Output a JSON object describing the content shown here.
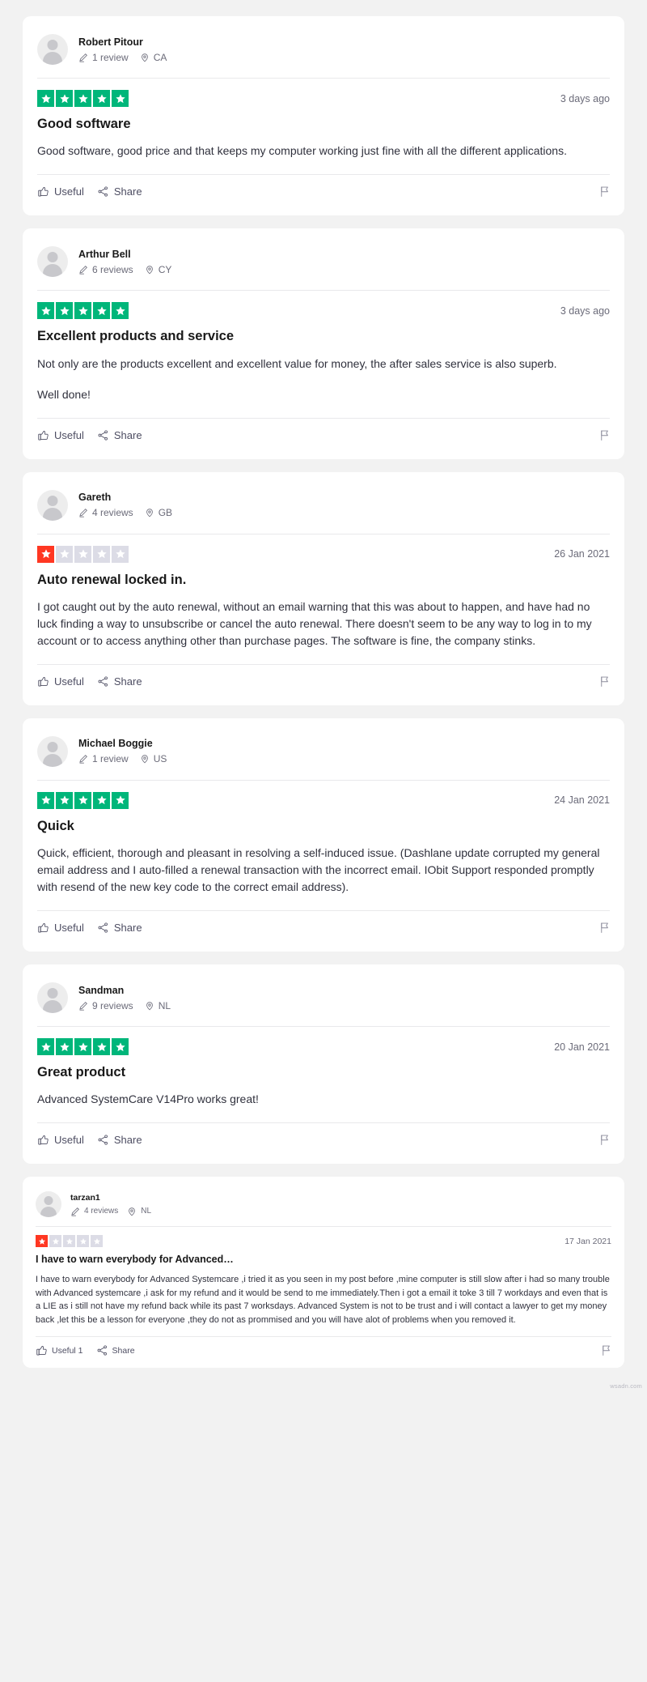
{
  "page": {
    "watermark": "wsadn.com",
    "brand_color_positive": "#00b67a",
    "brand_color_negative": "#ff3722",
    "star_off_color": "#dcdce6",
    "background": "#f2f2f2",
    "card_background": "#ffffff"
  },
  "labels": {
    "useful": "Useful",
    "share": "Share",
    "useful_with_count": "Useful 1",
    "thumbs_up_icon": "thumbs-up-icon",
    "share_icon": "share-icon",
    "flag_icon": "flag-icon",
    "pencil_icon": "pencil-icon",
    "location_pin_icon": "location-pin-icon",
    "star_icon": "star-icon",
    "avatar_icon": "avatar-placeholder-icon"
  },
  "reviews": [
    {
      "id": "review-robert-pitour",
      "author": "Robert Pitour",
      "review_count": "1 review",
      "country": "CA",
      "rating": 5,
      "rating_label": "5 out of 5 stars",
      "date": "3 days ago",
      "title": "Good software",
      "body": [
        "Good software, good price and that keeps my computer working just fine with all the different applications."
      ],
      "useful_label": "Useful",
      "share_label": "Share"
    },
    {
      "id": "review-arthur-bell",
      "author": "Arthur Bell",
      "review_count": "6 reviews",
      "country": "CY",
      "rating": 5,
      "rating_label": "5 out of 5 stars",
      "date": "3 days ago",
      "title": "Excellent products and service",
      "body": [
        "Not only are the products excellent and excellent value for money, the after sales service is also superb.",
        "Well done!"
      ],
      "useful_label": "Useful",
      "share_label": "Share"
    },
    {
      "id": "review-gareth",
      "author": "Gareth",
      "review_count": "4 reviews",
      "country": "GB",
      "rating": 1,
      "rating_label": "1 out of 5 stars",
      "date": "26 Jan 2021",
      "title": "Auto renewal locked in.",
      "body": [
        "I got caught out by the auto renewal, without an email warning that this was about to happen, and have had no luck finding a way to unsubscribe or cancel the auto renewal. There doesn't seem to be any way to log in to my account or to access anything other than purchase pages. The software is fine, the company stinks."
      ],
      "useful_label": "Useful",
      "share_label": "Share"
    },
    {
      "id": "review-michael-boggie",
      "author": "Michael Boggie",
      "review_count": "1 review",
      "country": "US",
      "rating": 5,
      "rating_label": "5 out of 5 stars",
      "date": "24 Jan 2021",
      "title": "Quick",
      "body": [
        "Quick, efficient, thorough and pleasant in resolving a self-induced issue. (Dashlane update corrupted my general email address and I auto-filled a renewal transaction with the incorrect email. IObit Support responded promptly with resend of the new key code to the correct email address)."
      ],
      "useful_label": "Useful",
      "share_label": "Share"
    },
    {
      "id": "review-sandman",
      "author": "Sandman",
      "review_count": "9 reviews",
      "country": "NL",
      "rating": 5,
      "rating_label": "5 out of 5 stars",
      "date": "20 Jan 2021",
      "title": "Great product",
      "body": [
        "Advanced SystemCare V14Pro works great!"
      ],
      "useful_label": "Useful",
      "share_label": "Share"
    },
    {
      "id": "review-tarzan1",
      "author": "tarzan1",
      "review_count": "4 reviews",
      "country": "NL",
      "rating": 1,
      "rating_label": "1 out of 5 stars",
      "date": "17 Jan 2021",
      "title": "I have to warn everybody for Advanced…",
      "body": [
        "I have to warn everybody for Advanced Systemcare ,i tried it as you seen in my post before ,mine computer is still slow after i had so many trouble with Advanced systemcare ,i ask for my refund and it would be send to me immediately.Then i got a email it toke 3 till 7 workdays and even that is a LIE as i still not have my refund back while its past 7 worksdays. Advanced System is not to be trust and i will contact a lawyer to get my money back ,let this be a lesson for everyone ,they do not as prommised and you will have alot of problems when you removed it."
      ],
      "useful_label": "Useful 1",
      "share_label": "Share"
    }
  ]
}
